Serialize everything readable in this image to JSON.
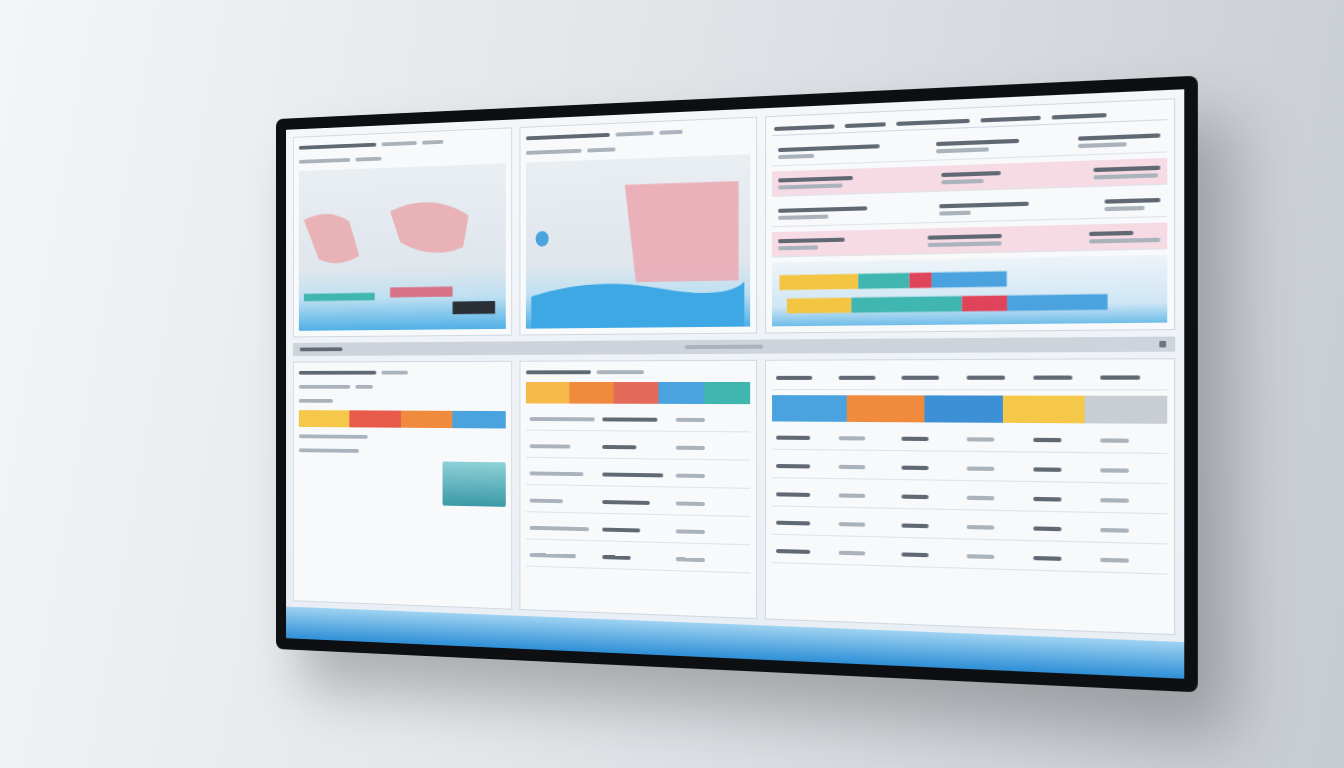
{
  "screen": {
    "kind": "dashboard"
  },
  "top_panels": [
    {
      "kind": "map"
    },
    {
      "kind": "map"
    },
    {
      "kind": "list-chart"
    }
  ],
  "list": {
    "rows": [
      {
        "selected": false
      },
      {
        "selected": true
      },
      {
        "selected": false
      },
      {
        "selected": true
      }
    ]
  },
  "chart": {
    "series": [
      {
        "color": "#f4c542",
        "values": [
          22,
          18
        ]
      },
      {
        "color": "#3fb6b0",
        "values": [
          14,
          30
        ]
      },
      {
        "color": "#e0445a",
        "values": [
          6,
          12
        ]
      },
      {
        "color": "#4aa3df",
        "values": [
          20,
          26
        ]
      }
    ]
  },
  "bands": [
    {
      "panel": "left",
      "stripes": [
        {
          "color": "#f6c84a"
        },
        {
          "color": "#e85b4a"
        },
        {
          "color": "#f08a3c"
        },
        {
          "color": "#4aa3df"
        }
      ]
    },
    {
      "panel": "middle",
      "stripes": [
        {
          "color": "#f6b94a"
        },
        {
          "color": "#f08a3c"
        },
        {
          "color": "#e46b5a"
        },
        {
          "color": "#4aa3df"
        },
        {
          "color": "#3fb6b0"
        }
      ]
    },
    {
      "panel": "table",
      "stripes": [
        {
          "color": "#4aa3df"
        },
        {
          "color": "#f08a3c"
        },
        {
          "color": "#3d8fd6"
        },
        {
          "color": "#f6c84a"
        },
        {
          "color": "#c9ced4"
        }
      ]
    }
  ],
  "side_list": {
    "rows": [
      {
        "selected": false
      },
      {
        "selected": false
      },
      {
        "selected": false
      },
      {
        "selected": false
      },
      {
        "selected": false
      },
      {
        "selected": false
      }
    ]
  },
  "table": {
    "column_count": 6,
    "rows": [
      {
        "selected": false
      },
      {
        "selected": false
      },
      {
        "selected": false
      },
      {
        "selected": false
      },
      {
        "selected": false
      }
    ]
  }
}
